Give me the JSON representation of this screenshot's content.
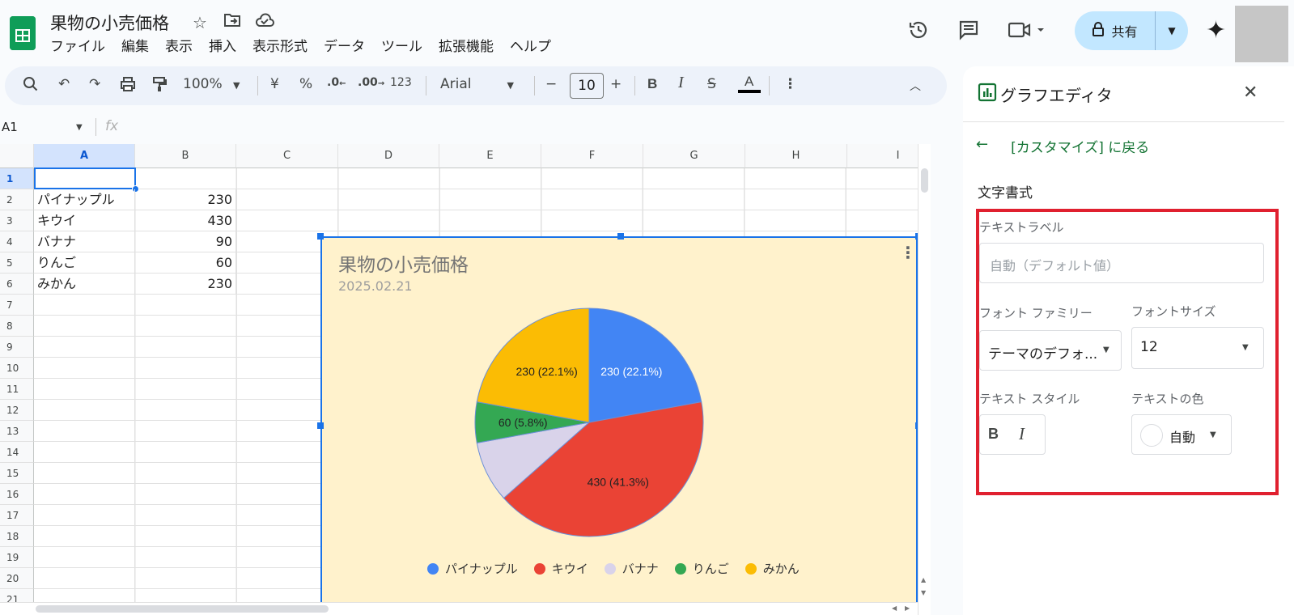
{
  "header": {
    "doc_title": "果物の小売価格",
    "menu": [
      "ファイル",
      "編集",
      "表示",
      "挿入",
      "表示形式",
      "データ",
      "ツール",
      "拡張機能",
      "ヘルプ"
    ],
    "share_label": "共有"
  },
  "toolbar": {
    "zoom": "100%",
    "currency": "¥",
    "percent": "%",
    "dec_less": ".0",
    "dec_more": ".00",
    "number_format": "123",
    "font": "Arial",
    "font_size": "10",
    "minus": "−",
    "plus": "+"
  },
  "formula_bar": {
    "name_box": "A1",
    "fx": "fx"
  },
  "grid": {
    "columns": [
      "A",
      "B",
      "C",
      "D",
      "E",
      "F",
      "G",
      "H",
      "I"
    ],
    "rows": [
      "1",
      "2",
      "3",
      "4",
      "5",
      "6",
      "7",
      "8",
      "9",
      "10",
      "11",
      "12",
      "13",
      "14",
      "15",
      "16",
      "17",
      "18",
      "19",
      "20",
      "21"
    ],
    "data": [
      {
        "name": "パイナップル",
        "value": "230"
      },
      {
        "name": "キウイ",
        "value": "430"
      },
      {
        "name": "バナナ",
        "value": "90"
      },
      {
        "name": "りんご",
        "value": "60"
      },
      {
        "name": "みかん",
        "value": "230"
      }
    ]
  },
  "chart_data": {
    "type": "pie",
    "title": "果物の小売価格",
    "subtitle": "2025.02.21",
    "categories": [
      "パイナップル",
      "キウイ",
      "バナナ",
      "りんご",
      "みかん"
    ],
    "values": [
      230,
      430,
      90,
      60,
      230
    ],
    "slice_labels": [
      "230 (22.1%)",
      "430 (41.3%)",
      "",
      "60 (5.8%)",
      "230 (22.1%)"
    ],
    "colors": [
      "#4285f4",
      "#ea4335",
      "#d9d3ea",
      "#34a853",
      "#fbbc04"
    ],
    "background": "#fff2cc",
    "legend_position": "bottom"
  },
  "panel": {
    "title": "グラフエディタ",
    "back_label": "[カスタマイズ] に戻る",
    "section": "文字書式",
    "text_label_caption": "テキストラベル",
    "text_label_placeholder": "自動（デフォルト値）",
    "font_family_caption": "フォント ファミリー",
    "font_family_value": "テーマのデフォ...",
    "font_size_caption": "フォントサイズ",
    "font_size_value": "12",
    "text_style_caption": "テキスト スタイル",
    "text_color_caption": "テキストの色",
    "text_color_value": "自動",
    "accent_color": "#137333",
    "highlight_color": "#e0202f"
  }
}
